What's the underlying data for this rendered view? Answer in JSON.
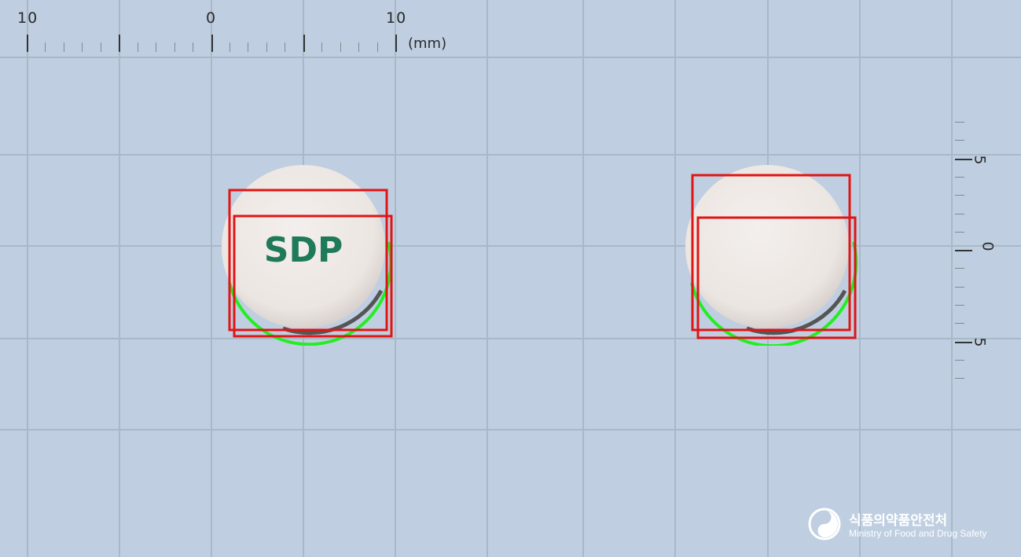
{
  "ruler_top": {
    "labels": [
      "10",
      "0",
      "10"
    ],
    "unit": "(mm)"
  },
  "ruler_right": {
    "labels": [
      "5",
      "0",
      "5"
    ]
  },
  "tablets": [
    {
      "imprint": "SDP",
      "imprint_color": "#1f7a5a"
    },
    {
      "imprint": ""
    }
  ],
  "colors": {
    "background": "#bfcfe1",
    "grid": "#a9b8c8",
    "tablet": "#efeae6",
    "detection_box": "#e11414",
    "edge_highlight": "#22ee22"
  },
  "logo": {
    "icon": "ministry-emblem-icon",
    "name_ko": "식품의약품안전처",
    "name_en": "Ministry of Food and Drug Safety"
  }
}
